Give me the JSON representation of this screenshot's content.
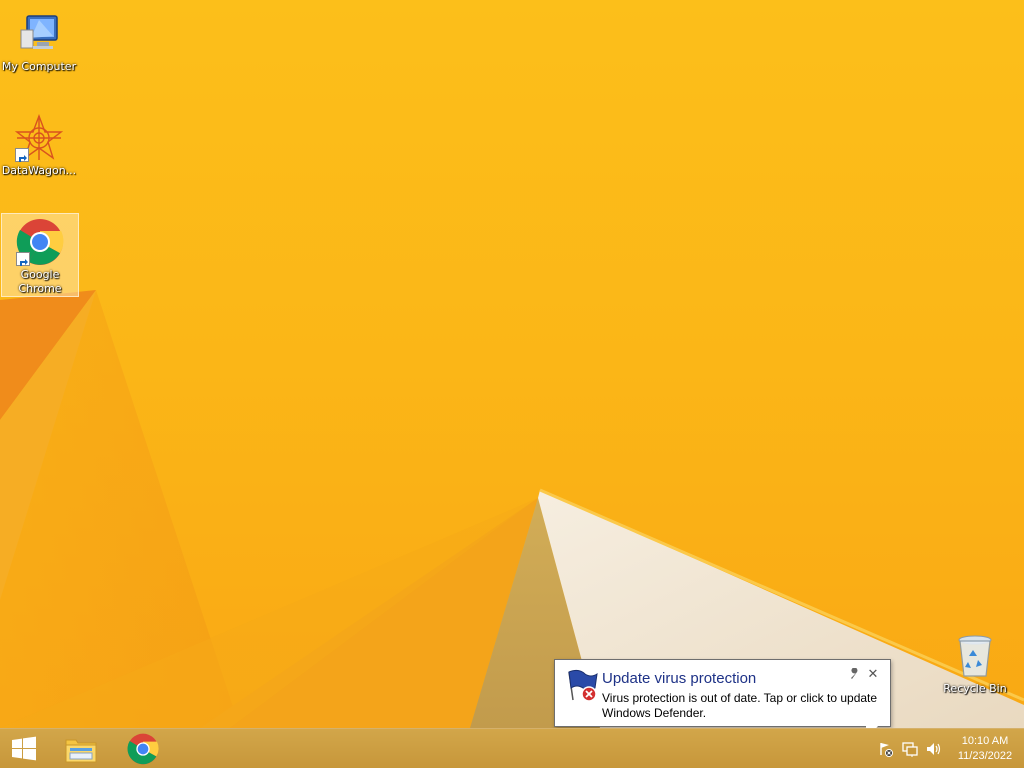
{
  "desktop": {
    "icons": [
      {
        "label": "My Computer",
        "icon": "computer-icon"
      },
      {
        "label": "DataWagon...",
        "icon": "datawagon-icon"
      },
      {
        "label": "Google Chrome",
        "icon": "chrome-icon"
      },
      {
        "label": "Recycle Bin",
        "icon": "recycle-bin-icon"
      }
    ]
  },
  "notification": {
    "title": "Update virus protection",
    "message": "Virus protection is out of date. Tap or click to update Windows Defender.",
    "icon": "windows-defender-flag-icon",
    "options_glyph": "🔧",
    "close_glyph": "✕"
  },
  "taskbar": {
    "pinned": [
      {
        "name": "start-button",
        "icon": "windows-logo-icon"
      },
      {
        "name": "file-explorer-button",
        "icon": "file-explorer-icon"
      },
      {
        "name": "chrome-button",
        "icon": "chrome-icon"
      }
    ],
    "tray_icons": [
      "action-center-icon",
      "network-icon",
      "volume-icon"
    ]
  },
  "clock": {
    "time": "10:10 AM",
    "date": "11/23/2022"
  },
  "colors": {
    "wallpaper": "#fbb617",
    "taskbar": "#c89a3a",
    "notification_title": "#1e3287"
  }
}
